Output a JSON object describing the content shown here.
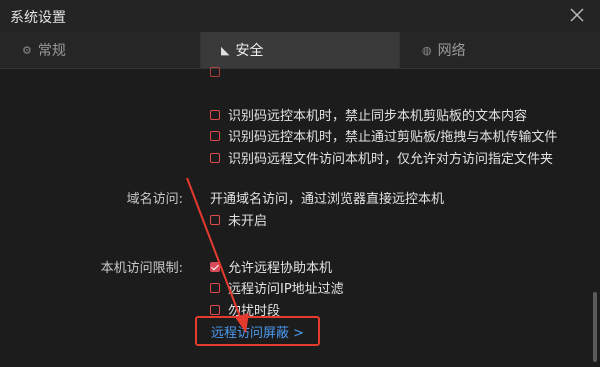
{
  "window": {
    "title": "系统设置"
  },
  "tabs": [
    {
      "icon": "gear-icon",
      "glyph": "⚙",
      "label": "常规"
    },
    {
      "icon": "shield-icon",
      "glyph": "◣",
      "label": "安全"
    },
    {
      "icon": "network-icon",
      "glyph": "◍",
      "label": "网络"
    }
  ],
  "privacy_options": [
    "识别码远控本机时，禁止同步本机剪贴板的文本内容",
    "识别码远控本机时，禁止通过剪贴板/拖拽与本机传输文件",
    "识别码远程文件访问本机时，仅允许对方访问指定文件夹"
  ],
  "domain_access": {
    "label": "域名访问:",
    "description": "开通域名访问，通过浏览器直接远控本机",
    "option": "未开启"
  },
  "access_limit": {
    "label": "本机访问限制:",
    "options": [
      {
        "text": "允许远程协助本机",
        "checked": true
      },
      {
        "text": "远程访问IP地址过滤",
        "checked": false
      },
      {
        "text": "勿扰时段",
        "checked": false
      }
    ],
    "link": "远程访问屏蔽 >"
  },
  "colors": {
    "accent": "#d94b5a",
    "link": "#4d9af0",
    "highlight_box": "#e53a2e"
  }
}
